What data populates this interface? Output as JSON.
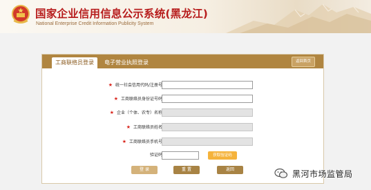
{
  "header": {
    "title": "国家企业信用信息公示系统(黑龙江)",
    "subtitle": "National Enterprise Credit Information Publicity System"
  },
  "panel": {
    "tabs": [
      {
        "label": "工商联络员登录",
        "active": true
      },
      {
        "label": "电子营业执照登录",
        "active": false
      }
    ],
    "back_home_label": "返回首页",
    "fields": [
      {
        "label": "统一社会信用代码/注册号",
        "required": true,
        "disabled": false,
        "value": ""
      },
      {
        "label": "工商联络员身份证号码",
        "required": true,
        "disabled": false,
        "value": ""
      },
      {
        "label": "企业（个体、农专）名称",
        "required": true,
        "disabled": true,
        "value": ""
      },
      {
        "label": "工商联络员姓名",
        "required": true,
        "disabled": true,
        "value": ""
      },
      {
        "label": "工商联络员手机号",
        "required": true,
        "disabled": true,
        "value": ""
      }
    ],
    "captcha": {
      "label": "验证码",
      "value": "",
      "button_label": "获取验证码"
    },
    "actions": {
      "login_label": "登 录",
      "reset_label": "重 置",
      "back_label": "返回"
    }
  },
  "watermark": {
    "text": "黑河市场监管局"
  }
}
